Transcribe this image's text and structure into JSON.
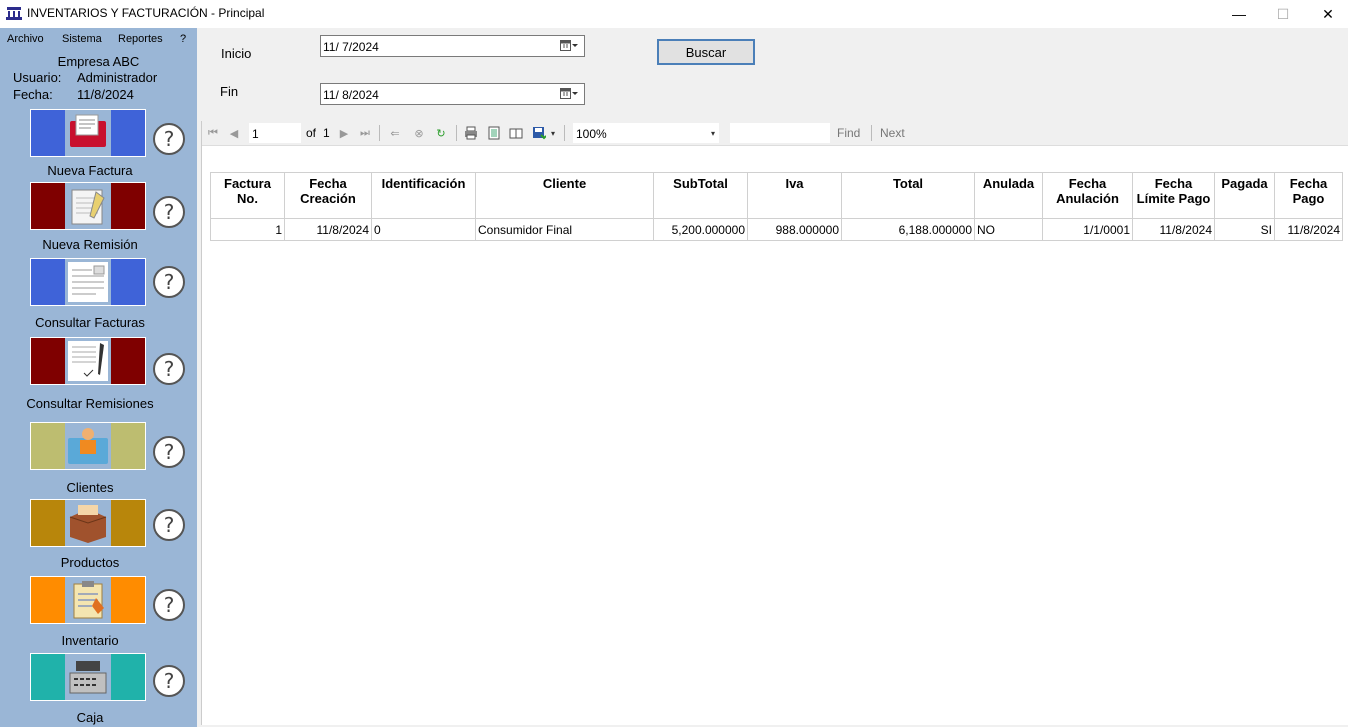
{
  "window": {
    "title": "INVENTARIOS Y FACTURACIÓN - Principal",
    "min": "—",
    "max": "☐",
    "close": "✕"
  },
  "menu": [
    "Archivo",
    "Sistema",
    "Reportes",
    "?"
  ],
  "company": {
    "name": "Empresa ABC",
    "user_label": "Usuario:",
    "user": "Administrador",
    "date_label": "Fecha:",
    "date": "11/8/2024"
  },
  "nav": [
    {
      "label": "Nueva Factura",
      "color": "#3f63d8",
      "icon": "invoice-icon"
    },
    {
      "label": "Nueva Remisión",
      "color": "#7f0000",
      "icon": "notepad-icon"
    },
    {
      "label": "Consultar Facturas",
      "color": "#3f63d8",
      "icon": "document-icon"
    },
    {
      "label": "Consultar Remisiones",
      "color": "#7f0000",
      "icon": "signed-document-icon"
    },
    {
      "label": "Clientes",
      "color": "#bdbd70",
      "icon": "client-folder-icon"
    },
    {
      "label": "Productos",
      "color": "#b8860b",
      "icon": "box-icon"
    },
    {
      "label": "Inventario",
      "color": "#ff8c00",
      "icon": "clipboard-icon"
    },
    {
      "label": "Caja",
      "color": "#20b2aa",
      "icon": "cash-register-icon"
    }
  ],
  "help_glyph": "?",
  "filters": {
    "inicio_label": "Inicio",
    "inicio": "11/  7/2024",
    "fin_label": "Fin",
    "fin": "11/  8/2024",
    "buscar": "Buscar"
  },
  "toolbar": {
    "page": "1",
    "of": "of",
    "total": "1",
    "zoom": "100%",
    "find": "Find",
    "next": "Next"
  },
  "report": {
    "headers": [
      "Factura No.",
      "Fecha Creación",
      "Identificación",
      "Cliente",
      "SubTotal",
      "Iva",
      "Total",
      "Anulada",
      "Fecha Anulación",
      "Fecha Límite Pago",
      "Pagada",
      "Fecha Pago"
    ],
    "rows": [
      [
        "1",
        "11/8/2024",
        "0",
        "Consumidor Final",
        "5,200.000000",
        "988.000000",
        "6,188.000000",
        "NO",
        "1/1/0001",
        "11/8/2024",
        "SI",
        "11/8/2024"
      ]
    ]
  }
}
